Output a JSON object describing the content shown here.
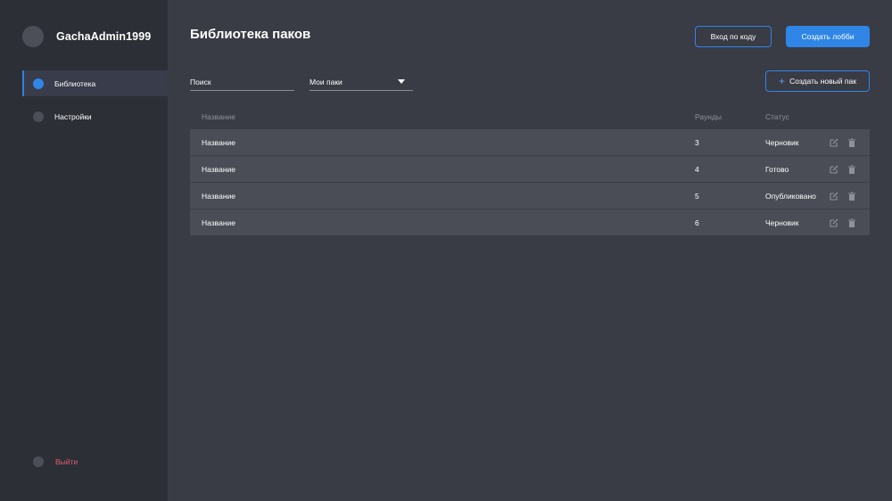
{
  "user": {
    "name": "GachaAdmin1999"
  },
  "sidebar": {
    "items": [
      {
        "label": "Библиотека",
        "active": true
      },
      {
        "label": "Настройки",
        "active": false
      }
    ],
    "logout_label": "Выйти"
  },
  "header": {
    "title": "Библиотека паков",
    "join_by_code_label": "Вход по коду",
    "create_lobby_label": "Создать лобби"
  },
  "filters": {
    "search_placeholder": "Поиск",
    "pack_filter_value": "Мои паки",
    "create_pack_label": "Создать новый пак"
  },
  "table": {
    "columns": {
      "name": "Название",
      "rounds": "Раунды",
      "status": "Статус"
    },
    "rows": [
      {
        "name": "Название",
        "rounds": "3",
        "status": "Черновик"
      },
      {
        "name": "Название",
        "rounds": "4",
        "status": "Готово"
      },
      {
        "name": "Название",
        "rounds": "5",
        "status": "Опубликовано"
      },
      {
        "name": "Название",
        "rounds": "6",
        "status": "Черновик"
      }
    ]
  },
  "colors": {
    "accent": "#2f86e6",
    "sidebar_bg": "#2d2f36",
    "main_bg": "#393b45",
    "row_bg": "#4b4d56",
    "danger": "#e05a72"
  }
}
